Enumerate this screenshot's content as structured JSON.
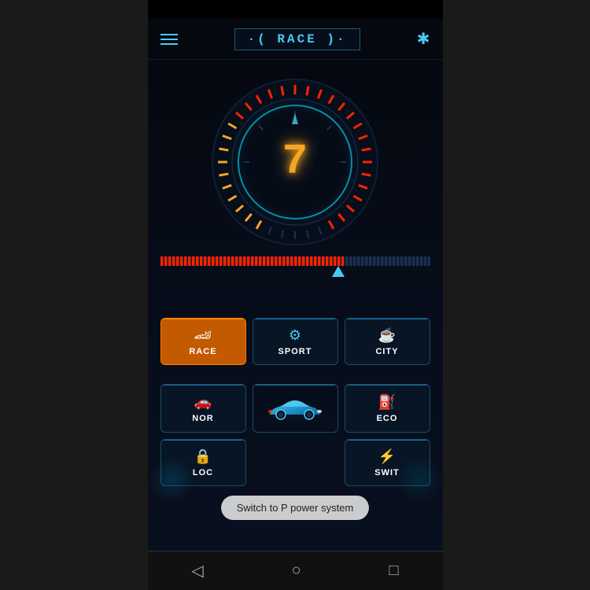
{
  "header": {
    "title": "·( RACE )·",
    "menu_label": "menu",
    "bluetooth_label": "bluetooth"
  },
  "speedometer": {
    "value": "7",
    "unit": ""
  },
  "progress": {
    "fill_percent": 68
  },
  "modes": {
    "row1": [
      {
        "id": "race",
        "label": "RACE",
        "icon": "🏎",
        "active": true
      },
      {
        "id": "sport",
        "label": "SPORT",
        "icon": "🎯",
        "active": false
      },
      {
        "id": "city",
        "label": "CITY",
        "icon": "☕",
        "active": false
      }
    ],
    "row2": [
      {
        "id": "nor",
        "label": "NOR",
        "icon": "🚗",
        "active": false
      },
      {
        "id": "car-center",
        "label": "",
        "icon": "car",
        "active": false
      },
      {
        "id": "eco",
        "label": "ECO",
        "icon": "⛽",
        "active": false
      }
    ],
    "row3": [
      {
        "id": "lock",
        "label": "LOC",
        "icon": "🔒",
        "active": false
      },
      {
        "id": "swit",
        "label": "SWIT",
        "icon": "⚡",
        "active": false
      }
    ]
  },
  "tooltip": {
    "text": "Switch to P power system"
  },
  "nav": {
    "back": "◁",
    "home": "○",
    "recent": "□"
  }
}
